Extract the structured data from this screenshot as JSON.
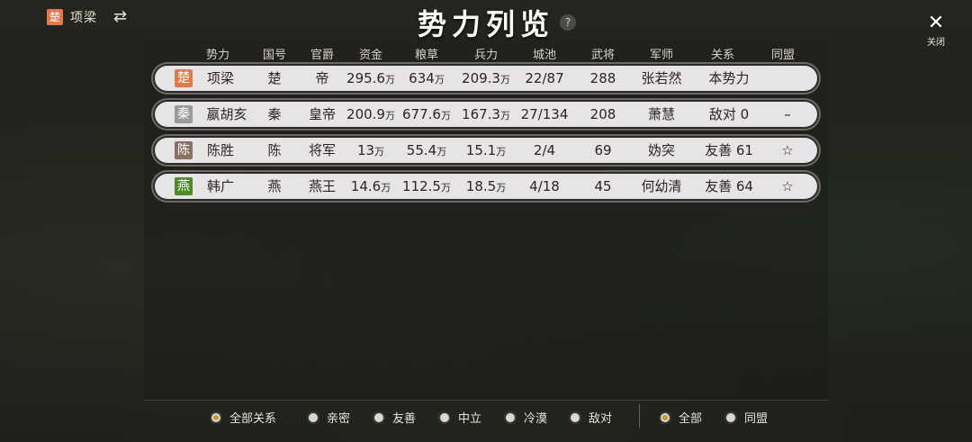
{
  "player": {
    "chip": "楚",
    "chip_color": "#e07a4a",
    "name": "项梁"
  },
  "title": "势力列览",
  "help_icon": "?",
  "close": {
    "icon": "✕",
    "label": "关闭"
  },
  "headers": [
    "势力",
    "国号",
    "官爵",
    "资金",
    "粮草",
    "兵力",
    "城池",
    "武将",
    "军师",
    "关系",
    "同盟"
  ],
  "rows": [
    {
      "chip": "楚",
      "chip_color": "#e07a4a",
      "name": "项梁",
      "state": "楚",
      "rank": "帝",
      "funds": "295.6",
      "grain": "634",
      "troops": "209.3",
      "cities": "22/87",
      "generals": "288",
      "advisor": "张若然",
      "relation": "本势力",
      "alliance": ""
    },
    {
      "chip": "秦",
      "chip_color": "#9c9a98",
      "name": "嬴胡亥",
      "state": "秦",
      "rank": "皇帝",
      "funds": "200.9",
      "grain": "677.6",
      "troops": "167.3",
      "cities": "27/134",
      "generals": "208",
      "advisor": "萧慧",
      "relation": "敌对 0",
      "alliance": "–"
    },
    {
      "chip": "陈",
      "chip_color": "#8a7262",
      "name": "陈胜",
      "state": "陈",
      "rank": "将军",
      "funds": "13",
      "grain": "55.4",
      "troops": "15.1",
      "cities": "2/4",
      "generals": "69",
      "advisor": "妫突",
      "relation": "友善 61",
      "alliance": "☆"
    },
    {
      "chip": "燕",
      "chip_color": "#4f8a2a",
      "name": "韩广",
      "state": "燕",
      "rank": "燕王",
      "funds": "14.6",
      "grain": "112.5",
      "troops": "18.5",
      "cities": "4/18",
      "generals": "45",
      "advisor": "何幼清",
      "relation": "友善 64",
      "alliance": "☆"
    }
  ],
  "unit": "万",
  "relation_filters": [
    {
      "label": "全部关系",
      "selected": true
    },
    {
      "label": "亲密",
      "selected": false
    },
    {
      "label": "友善",
      "selected": false
    },
    {
      "label": "中立",
      "selected": false
    },
    {
      "label": "冷漠",
      "selected": false
    },
    {
      "label": "敌对",
      "selected": false
    }
  ],
  "alliance_filters": [
    {
      "label": "全部",
      "selected": true
    },
    {
      "label": "同盟",
      "selected": false
    }
  ]
}
